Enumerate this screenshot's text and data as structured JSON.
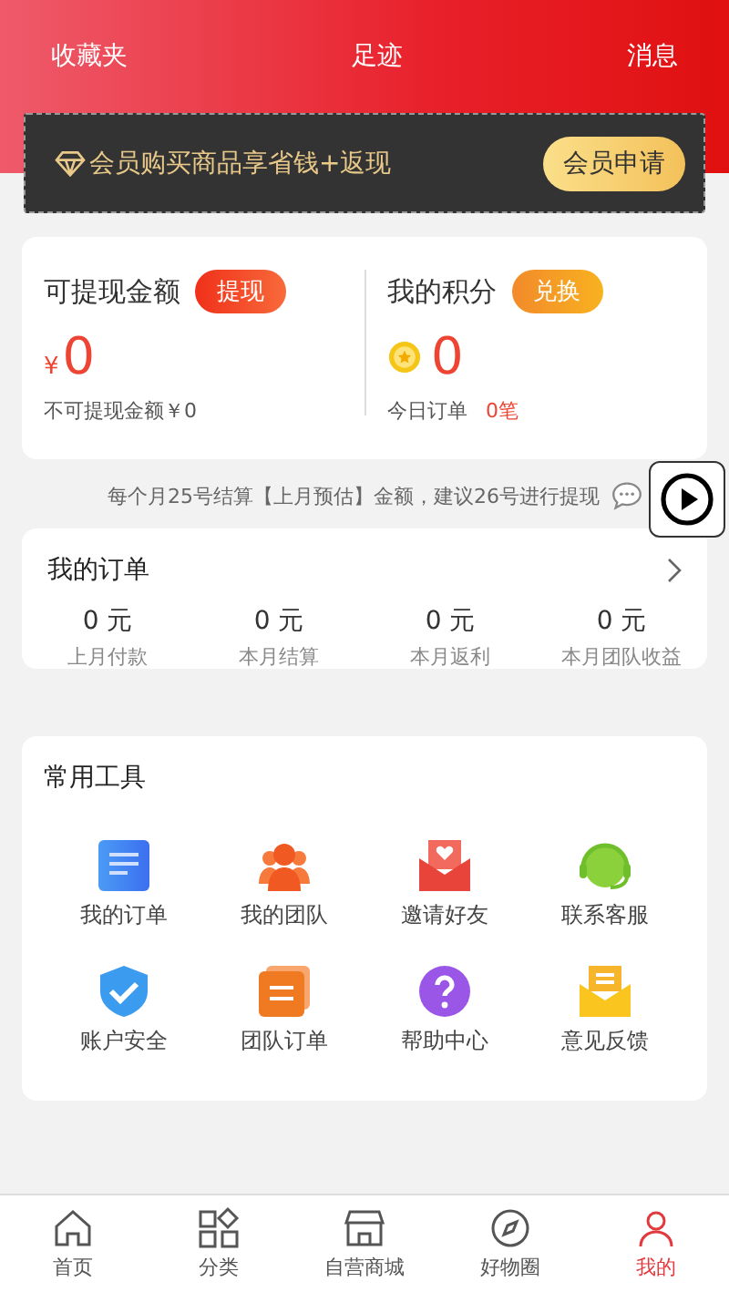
{
  "header": {
    "links": [
      "收藏夹",
      "足迹",
      "消息"
    ]
  },
  "member_banner": {
    "text": "会员购买商品享省钱+返现",
    "button": "会员申请"
  },
  "balance": {
    "title": "可提现金额",
    "action": "提现",
    "currency": "¥",
    "amount": "0",
    "note": "不可提现金额￥0"
  },
  "points": {
    "title": "我的积分",
    "action": "兑换",
    "amount": "0",
    "note_label": "今日订单",
    "note_value": "0笔"
  },
  "notice": "每个月25号结算【上月预估】金额，建议26号进行提现",
  "orders": {
    "title": "我的订单",
    "stats": [
      {
        "value": "0 元",
        "label": "上月付款"
      },
      {
        "value": "0 元",
        "label": "本月结算"
      },
      {
        "value": "0 元",
        "label": "本月返利"
      },
      {
        "value": "0 元",
        "label": "本月团队收益"
      }
    ]
  },
  "tools": {
    "title": "常用工具",
    "items": [
      {
        "kind": "orders",
        "label": "我的订单"
      },
      {
        "kind": "team",
        "label": "我的团队"
      },
      {
        "kind": "invite",
        "label": "邀请好友"
      },
      {
        "kind": "service",
        "label": "联系客服"
      },
      {
        "kind": "security",
        "label": "账户安全"
      },
      {
        "kind": "teamorders",
        "label": "团队订单"
      },
      {
        "kind": "help",
        "label": "帮助中心"
      },
      {
        "kind": "feedback",
        "label": "意见反馈"
      }
    ]
  },
  "tab_bar": [
    {
      "kind": "home",
      "label": "首页",
      "selected": false
    },
    {
      "kind": "category",
      "label": "分类",
      "selected": false
    },
    {
      "kind": "store",
      "label": "自营商城",
      "selected": false
    },
    {
      "kind": "circle",
      "label": "好物圈",
      "selected": false
    },
    {
      "kind": "me",
      "label": "我的",
      "selected": true
    }
  ]
}
